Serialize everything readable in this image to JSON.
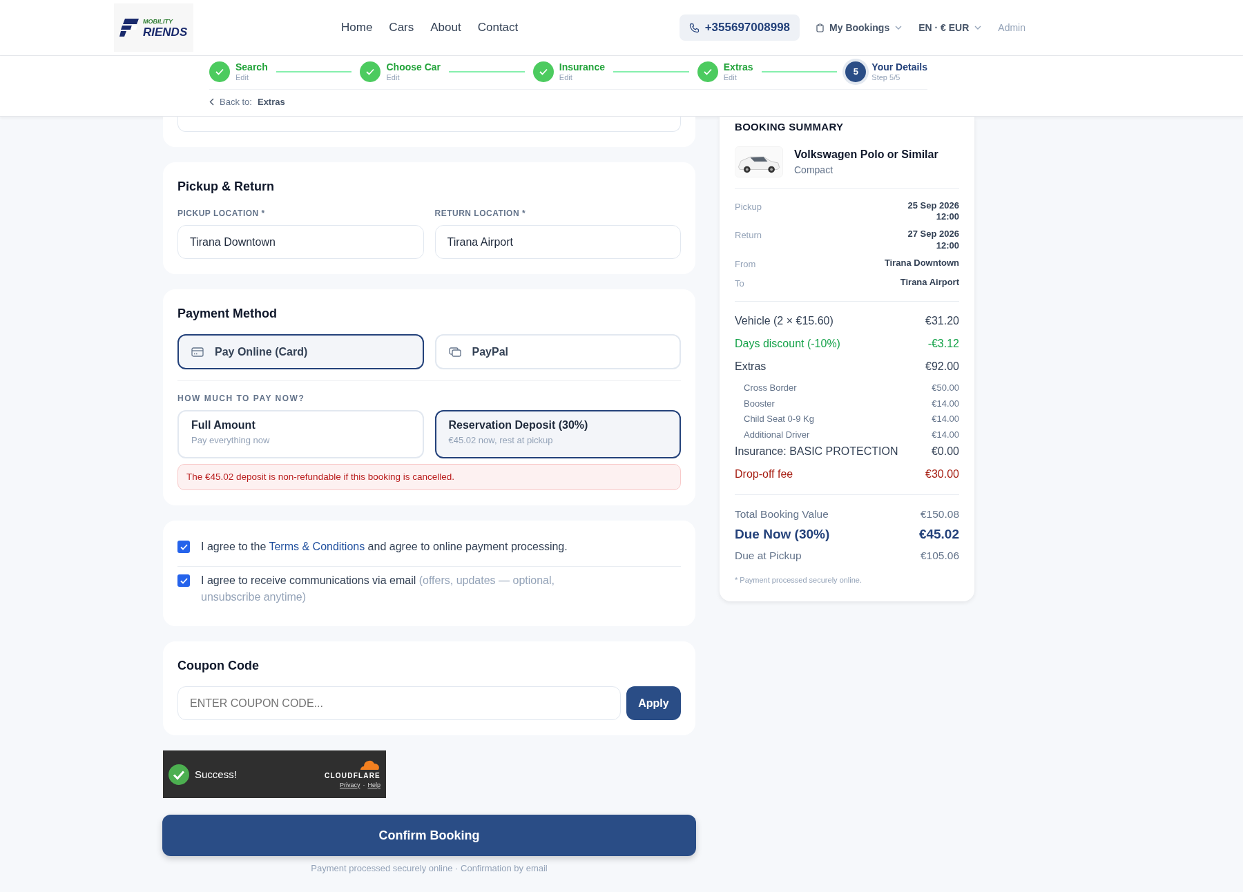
{
  "header": {
    "logo": {
      "top": "MOBILITY",
      "bottom": "RIENDS"
    },
    "nav": [
      {
        "label": "Home"
      },
      {
        "label": "Cars"
      },
      {
        "label": "About"
      },
      {
        "label": "Contact"
      }
    ],
    "phone": "+355697008998",
    "my_bookings": "My Bookings",
    "locale": "EN · € EUR",
    "admin": "Admin"
  },
  "steps": [
    {
      "label": "Search",
      "sub": "Edit",
      "done": true
    },
    {
      "label": "Choose Car",
      "sub": "Edit",
      "done": true
    },
    {
      "label": "Insurance",
      "sub": "Edit",
      "done": true
    },
    {
      "label": "Extras",
      "sub": "Edit",
      "done": true
    },
    {
      "label": "Your Details",
      "sub": "Step 5/5",
      "done": false,
      "number": "5"
    }
  ],
  "back": {
    "prefix": "Back to:",
    "target": "Extras"
  },
  "pickup_return": {
    "title": "Pickup & Return",
    "fields": [
      {
        "label": "PICKUP LOCATION *",
        "value": "Tirana Downtown"
      },
      {
        "label": "RETURN LOCATION *",
        "value": "Tirana Airport"
      }
    ]
  },
  "payment": {
    "title": "Payment Method",
    "methods": [
      {
        "label": "Pay Online (Card)",
        "selected": true
      },
      {
        "label": "PayPal",
        "selected": false
      }
    ],
    "amount_label": "HOW MUCH TO PAY NOW?",
    "options": [
      {
        "title": "Full Amount",
        "sub": "Pay everything now",
        "selected": false
      },
      {
        "title": "Reservation Deposit (30%)",
        "sub": "€45.02 now, rest at pickup",
        "selected": true
      }
    ],
    "alert": "The €45.02 deposit is non-refundable if this booking is cancelled."
  },
  "agreements": [
    {
      "text": "I agree to the",
      "link": "Terms & Conditions",
      "after": "and agree to online payment processing.",
      "checked": true
    },
    {
      "text": "I agree to receive communications via email",
      "note": "(offers, updates — optional, unsubscribe anytime)",
      "checked": true
    }
  ],
  "coupon": {
    "title": "Coupon Code",
    "placeholder": "ENTER COUPON CODE...",
    "button": "Apply"
  },
  "captcha": {
    "status": "Success!",
    "brand": "CLOUDFLARE",
    "links": [
      "Privacy",
      "Help"
    ],
    "separator": "·"
  },
  "confirm": {
    "button": "Confirm Booking",
    "footnote": "Payment processed securely online · Confirmation by email"
  },
  "summary": {
    "title": "BOOKING SUMMARY",
    "car": {
      "name": "Volkswagen Polo or Similar",
      "category": "Compact"
    },
    "details": [
      {
        "label": "Pickup",
        "value": [
          "25 Sep 2026",
          "12:00"
        ]
      },
      {
        "label": "Return",
        "value": [
          "27 Sep 2026",
          "12:00"
        ]
      },
      {
        "label": "From",
        "value": [
          "Tirana Downtown"
        ]
      },
      {
        "label": "To",
        "value": [
          "Tirana Airport"
        ]
      }
    ],
    "lines": [
      {
        "label": "Vehicle (2 × €15.60)",
        "value": "€31.20",
        "kind": "normal"
      },
      {
        "label": "Days discount (-10%)",
        "value": "-€3.12",
        "kind": "discount"
      },
      {
        "label": "Extras",
        "value": "€92.00",
        "kind": "normal"
      },
      {
        "label": "Cross Border",
        "value": "€50.00",
        "kind": "sub"
      },
      {
        "label": "Booster",
        "value": "€14.00",
        "kind": "sub"
      },
      {
        "label": "Child Seat 0-9 Kg",
        "value": "€14.00",
        "kind": "sub"
      },
      {
        "label": "Additional Driver",
        "value": "€14.00",
        "kind": "sub"
      },
      {
        "label": "Insurance: BASIC PROTECTION",
        "value": "€0.00",
        "kind": "normal"
      },
      {
        "label": "Drop-off fee",
        "value": "€30.00",
        "kind": "fee"
      }
    ],
    "totals": [
      {
        "label": "Total Booking Value",
        "value": "€150.08",
        "kind": "normal"
      },
      {
        "label": "Due Now (30%)",
        "value": "€45.02",
        "kind": "due"
      },
      {
        "label": "Due at Pickup",
        "value": "€105.06",
        "kind": "normal"
      }
    ],
    "note": "* Payment processed securely online."
  }
}
